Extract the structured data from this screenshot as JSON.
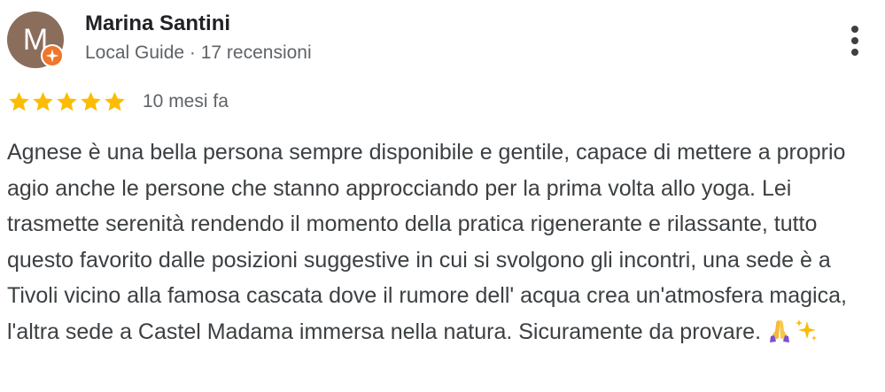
{
  "review": {
    "author": {
      "initial": "M",
      "name": "Marina Santini",
      "meta": "Local Guide · 17 recensioni",
      "avatar_color": "#8b6d5c",
      "badge_color": "#f0762b",
      "badge_icon": "local-guide-badge-icon"
    },
    "rating": {
      "stars": 5,
      "max": 5,
      "star_color": "#fbbc04"
    },
    "time": "10 mesi fa",
    "text": "Agnese è una bella persona sempre disponibile e gentile, capace di mettere a proprio agio anche le persone che stanno approcciando per la prima volta allo yoga. Lei trasmette serenità rendendo il momento della pratica rigenerante e rilassante, tutto questo favorito dalle posizioni suggestive in cui si svolgono gli incontri, una sede è a Tivoli vicino alla famosa cascata dove il rumore dell' acqua crea un'atmosfera magica, l'altra sede a Castel Madama immersa nella natura. Sicuramente da provare.",
    "emojis": [
      "folded-hands-emoji",
      "sparkles-emoji"
    ]
  },
  "menu": {
    "icon": "more-vert-icon"
  }
}
